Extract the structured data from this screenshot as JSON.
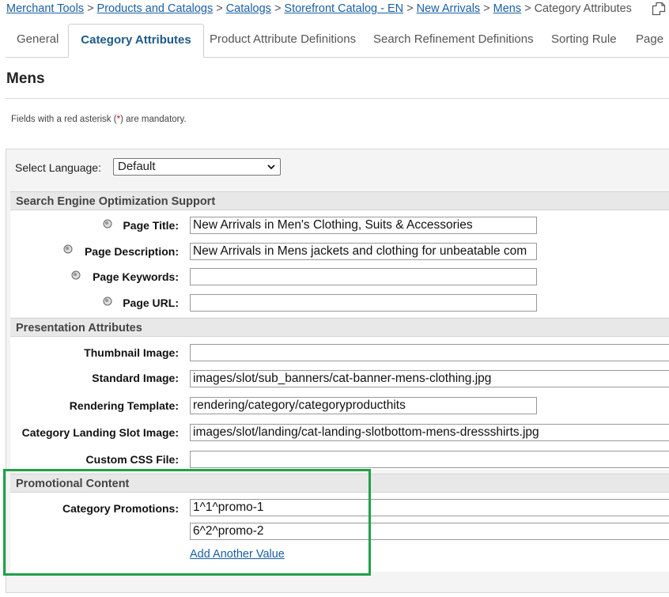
{
  "breadcrumb": {
    "items": [
      "Merchant Tools",
      "Products and Catalogs",
      "Catalogs",
      "Storefront Catalog - EN",
      "New Arrivals",
      "Mens"
    ],
    "current": "Category Attributes",
    "separator": ">"
  },
  "tabs": [
    {
      "label": "General"
    },
    {
      "label": "Category Attributes",
      "active": true
    },
    {
      "label": "Product Attribute Definitions"
    },
    {
      "label": "Search Refinement Definitions"
    },
    {
      "label": "Sorting Rule"
    },
    {
      "label": "Page"
    }
  ],
  "page_title": "Mens",
  "mandatory_note": {
    "before": "Fields with a red asterisk (",
    "star": "*",
    "after": ") are mandatory."
  },
  "language": {
    "label": "Select Language:",
    "selected": "Default"
  },
  "seo": {
    "heading": "Search Engine Optimization Support",
    "page_title_label": "Page Title:",
    "page_title_value": "New Arrivals in Men's Clothing, Suits & Accessories",
    "page_description_label": "Page Description:",
    "page_description_value": "New Arrivals in Mens  jackets and clothing for unbeatable com",
    "page_keywords_label": "Page Keywords:",
    "page_keywords_value": "",
    "page_url_label": "Page URL:",
    "page_url_value": ""
  },
  "presentation": {
    "heading": "Presentation Attributes",
    "thumbnail_label": "Thumbnail Image:",
    "thumbnail_value": "",
    "standard_label": "Standard Image:",
    "standard_value": "images/slot/sub_banners/cat-banner-mens-clothing.jpg",
    "rendering_label": "Rendering Template:",
    "rendering_value": "rendering/category/categoryproducthits",
    "landing_label": "Category Landing Slot Image:",
    "landing_value": "images/slot/landing/cat-landing-slotbottom-mens-dressshirts.jpg",
    "css_label": "Custom CSS File:",
    "css_value": ""
  },
  "promotional": {
    "heading": "Promotional Content",
    "promotions_label": "Category Promotions:",
    "values": [
      "1^1^promo-1",
      "6^2^promo-2"
    ],
    "add_link": "Add Another Value"
  },
  "colors": {
    "link": "#1a5fa6",
    "active_tab": "#1e5a8a",
    "highlight": "#22a04a",
    "required": "#dd0000"
  },
  "icons": {
    "copy": "copy-icon",
    "localized": "globe-icon",
    "dropdown": "chevron-down-icon"
  }
}
